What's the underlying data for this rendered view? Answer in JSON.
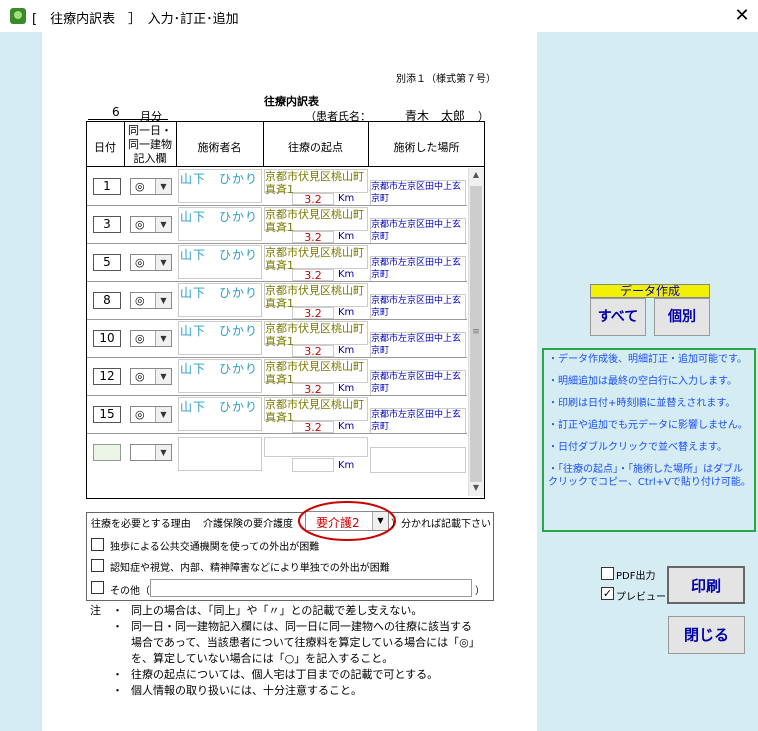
{
  "window": {
    "title": "[　往療内訳表　］　入力･訂正･追加",
    "close_glyph": "✕"
  },
  "form": {
    "form_ref": "別添１（様式第７号）",
    "month": "6",
    "month_suffix": "月分",
    "doc_title": "往療内訳表",
    "patient_label": "（患者氏名：",
    "patient_name": "青木　太郎",
    "patient_close": "）",
    "headers": {
      "day": "日付",
      "same_bldg": [
        "同一日・",
        "同一建物",
        "記入欄"
      ],
      "practitioner": "施術者名",
      "start": "往療の起点",
      "place": "施術した場所"
    },
    "km_unit": "Km",
    "rows": [
      {
        "day": "1",
        "mark": "◎",
        "name": "山下　ひかり",
        "start1": "京都市伏見区桃山町",
        "start2": "真斉1",
        "km": "3.2",
        "place": "京都市左京区田中上玄京町"
      },
      {
        "day": "3",
        "mark": "◎",
        "name": "山下　ひかり",
        "start1": "京都市伏見区桃山町",
        "start2": "真斉1",
        "km": "3.2",
        "place": "京都市左京区田中上玄京町"
      },
      {
        "day": "5",
        "mark": "◎",
        "name": "山下　ひかり",
        "start1": "京都市伏見区桃山町",
        "start2": "真斉1",
        "km": "3.2",
        "place": "京都市左京区田中上玄京町"
      },
      {
        "day": "8",
        "mark": "◎",
        "name": "山下　ひかり",
        "start1": "京都市伏見区桃山町",
        "start2": "真斉1",
        "km": "3.2",
        "place": "京都市左京区田中上玄京町"
      },
      {
        "day": "10",
        "mark": "◎",
        "name": "山下　ひかり",
        "start1": "京都市伏見区桃山町",
        "start2": "真斉1",
        "km": "3.2",
        "place": "京都市左京区田中上玄京町"
      },
      {
        "day": "12",
        "mark": "◎",
        "name": "山下　ひかり",
        "start1": "京都市伏見区桃山町",
        "start2": "真斉1",
        "km": "3.2",
        "place": "京都市左京区田中上玄京町"
      },
      {
        "day": "15",
        "mark": "◎",
        "name": "山下　ひかり",
        "start1": "京都市伏見区桃山町",
        "start2": "真斉1",
        "km": "3.2",
        "place": "京都市左京区田中上玄京町"
      }
    ],
    "reason_label": "往療を必要とする理由",
    "care_label": "介護保険の要介護度",
    "care_paren_open": "（",
    "care_value": "要介護2",
    "care_suffix": "）分かれば記載下さい",
    "check1": "独歩による公共交通機関を使っての外出が困難",
    "check2": "認知症や視覚、内部、精神障害などにより単独での外出が困難",
    "check3_label": "その他（",
    "check3_close": "）",
    "notes_head": "注",
    "bullet": "・",
    "notes": [
      "同上の場合は、「同上」や「〃」との記載で差し支えない。",
      "同一日・同一建物記入欄には、同一日に同一建物への往療に該当する場合であって、当該患者について往療料を算定している場合には「◎」を、算定していない場合には「○」を記入すること。",
      "往療の起点については、個人宅は丁目までの記載で可とする。",
      "個人情報の取り扱いには、十分注意すること。"
    ]
  },
  "panel": {
    "data_create": "データ作成",
    "btn_all": "すべて",
    "btn_individual": "個別",
    "info": [
      "・データ作成後、明細訂正・追加可能です。",
      "・明細追加は最終の空白行に入力します。",
      "・印刷は日付+時刻順に並替えされます。",
      "・訂正や追加でも元データに影響しません。",
      "・日付ダブルクリックで並べ替えます。",
      "・「往療の起点」・「施術した場所」はダブルクリックでコピー、Ctrl+Vで貼り付け可能。"
    ],
    "pdf_label": "PDF出力",
    "pdf_checked": false,
    "preview_label": "プレビュー",
    "preview_checked": true,
    "btn_print": "印刷",
    "btn_close": "閉じる"
  },
  "colors": {
    "panel_bg": "#d5ecf2",
    "info_border": "#2aa64a",
    "banner": "#f0f000",
    "highlight_circle": "#cc0000"
  }
}
